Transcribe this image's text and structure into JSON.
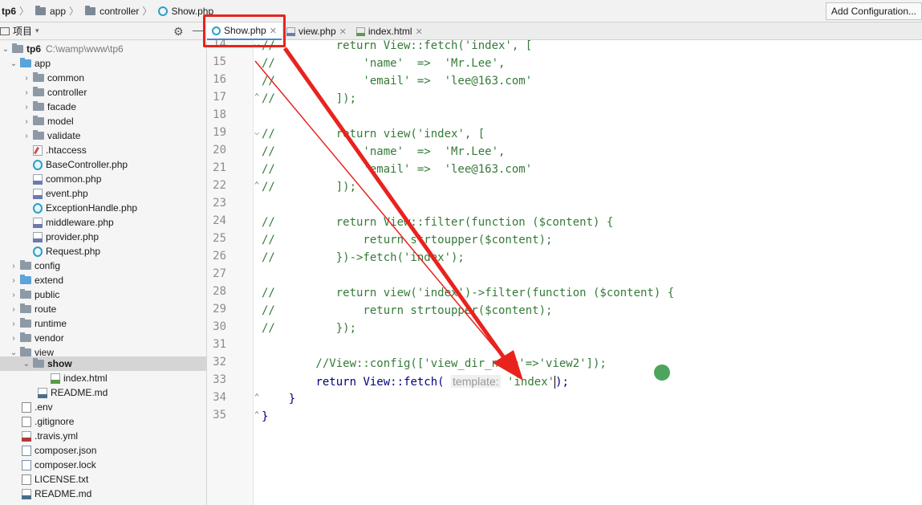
{
  "breadcrumb": {
    "project": "tp6",
    "folder1": "app",
    "folder2": "controller",
    "file": "Show.php"
  },
  "toolbar": {
    "add_config_label": "Add Configuration..."
  },
  "project_panel": {
    "title": "项目",
    "tree": [
      {
        "label": "tp6",
        "path": "C:\\wamp\\www\\tp6",
        "type": "folder"
      },
      {
        "label": "app",
        "type": "folder"
      },
      {
        "label": "common",
        "type": "folder"
      },
      {
        "label": "controller",
        "type": "folder"
      },
      {
        "label": "facade",
        "type": "folder"
      },
      {
        "label": "model",
        "type": "folder"
      },
      {
        "label": "validate",
        "type": "folder"
      },
      {
        "label": ".htaccess",
        "type": "file"
      },
      {
        "label": "BaseController.php",
        "type": "file"
      },
      {
        "label": "common.php",
        "type": "file"
      },
      {
        "label": "event.php",
        "type": "file"
      },
      {
        "label": "ExceptionHandle.php",
        "type": "file"
      },
      {
        "label": "middleware.php",
        "type": "file"
      },
      {
        "label": "provider.php",
        "type": "file"
      },
      {
        "label": "Request.php",
        "type": "file"
      },
      {
        "label": "config",
        "type": "folder"
      },
      {
        "label": "extend",
        "type": "folder"
      },
      {
        "label": "public",
        "type": "folder"
      },
      {
        "label": "route",
        "type": "folder"
      },
      {
        "label": "runtime",
        "type": "folder"
      },
      {
        "label": "vendor",
        "type": "folder"
      },
      {
        "label": "view",
        "type": "folder"
      },
      {
        "label": "show",
        "type": "folder"
      },
      {
        "label": "index.html",
        "type": "file"
      },
      {
        "label": "README.md",
        "type": "file"
      },
      {
        "label": ".env",
        "type": "file"
      },
      {
        "label": ".gitignore",
        "type": "file"
      },
      {
        "label": ".travis.yml",
        "type": "file"
      },
      {
        "label": "composer.json",
        "type": "file"
      },
      {
        "label": "composer.lock",
        "type": "file"
      },
      {
        "label": "LICENSE.txt",
        "type": "file"
      },
      {
        "label": "README.md",
        "type": "file"
      }
    ]
  },
  "tabs": [
    {
      "label": "Show.php",
      "active": true
    },
    {
      "label": "view.php",
      "active": false
    },
    {
      "label": "index.html",
      "active": false
    }
  ],
  "editor": {
    "lines": [
      {
        "num": "14",
        "text": "//         return View::fetch('index', ["
      },
      {
        "num": "15",
        "text": "//             'name'  =>  'Mr.Lee',"
      },
      {
        "num": "16",
        "text": "//             'email' =>  'lee@163.com'"
      },
      {
        "num": "17",
        "text": "//         ]);"
      },
      {
        "num": "18",
        "text": ""
      },
      {
        "num": "19",
        "text": "//         return view('index', ["
      },
      {
        "num": "20",
        "text": "//             'name'  =>  'Mr.Lee',"
      },
      {
        "num": "21",
        "text": "//             'email' =>  'lee@163.com'"
      },
      {
        "num": "22",
        "text": "//         ]);"
      },
      {
        "num": "23",
        "text": ""
      },
      {
        "num": "24",
        "text": "//         return View::filter(function ($content) {"
      },
      {
        "num": "25",
        "text": "//             return strtoupper($content);"
      },
      {
        "num": "26",
        "text": "//         })->fetch('index');"
      },
      {
        "num": "27",
        "text": ""
      },
      {
        "num": "28",
        "text": "//         return view('index')->filter(function ($content) {"
      },
      {
        "num": "29",
        "text": "//             return strtoupper($content);"
      },
      {
        "num": "30",
        "text": "//         });"
      },
      {
        "num": "31",
        "text": ""
      },
      {
        "num": "32",
        "text": "        //View::config(['view_dir_name'=>'view2']);"
      },
      {
        "num": "33",
        "text": ""
      },
      {
        "num": "34",
        "text": "    }"
      },
      {
        "num": "35",
        "text": "}"
      }
    ],
    "line33": {
      "indent": "        ",
      "kw": "return",
      "call": " View::fetch( ",
      "hint": "template:",
      "arg": " 'index'",
      "tail": ");"
    }
  },
  "colors": {
    "annotation_red": "#e8231e",
    "comment_green": "#357a38",
    "keyword_navy": "#000080",
    "cursor_dot": "#3a9a4a"
  }
}
